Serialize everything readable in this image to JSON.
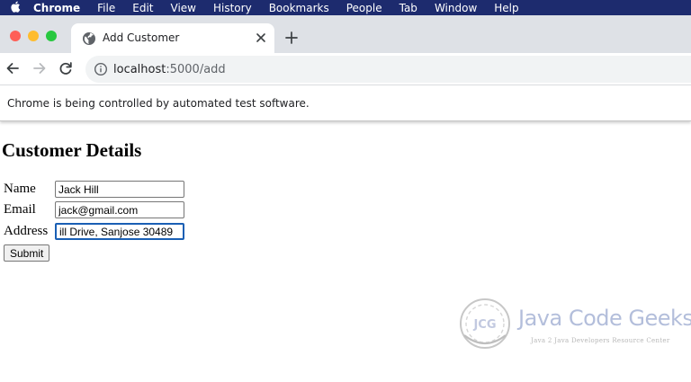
{
  "menubar": {
    "items": [
      "Chrome",
      "File",
      "Edit",
      "View",
      "History",
      "Bookmarks",
      "People",
      "Tab",
      "Window",
      "Help"
    ]
  },
  "tab": {
    "title": "Add Customer"
  },
  "toolbar": {
    "url_host": "localhost",
    "url_path": ":5000/add"
  },
  "infobar": {
    "message": "Chrome is being controlled by automated test software."
  },
  "page": {
    "title": "Customer Details",
    "fields": {
      "name": {
        "label": "Name",
        "value": "Jack Hill"
      },
      "email": {
        "label": "Email",
        "value": "jack@gmail.com"
      },
      "address": {
        "label": "Address",
        "value": "ill Drive, Sanjose 30489"
      }
    },
    "submit_label": "Submit"
  },
  "watermark": {
    "logo_text": "JCG",
    "name": "Java Code Geeks",
    "tagline": "Java 2 Java Developers Resource Center"
  },
  "colors": {
    "menubar": "#1d2b6e",
    "tabstrip": "#dee1e6",
    "focus_ring": "#1a5fb4"
  }
}
